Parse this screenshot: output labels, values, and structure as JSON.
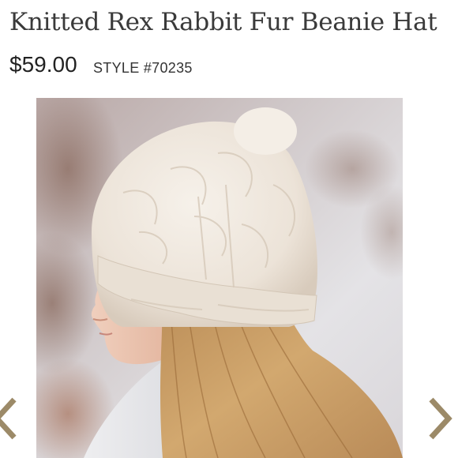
{
  "product": {
    "title": "Knitted Rex Rabbit Fur Beanie Hat",
    "price": "$59.00",
    "style": "STYLE #70235"
  },
  "gallery": {
    "prev_icon": "chevron-left-icon",
    "next_icon": "chevron-right-icon",
    "arrow_color": "#9c8a68"
  },
  "colors": {
    "title_text": "#3a3a3a",
    "price_text": "#222222",
    "fur": "#efe7dd",
    "hair": "#c9a066"
  }
}
